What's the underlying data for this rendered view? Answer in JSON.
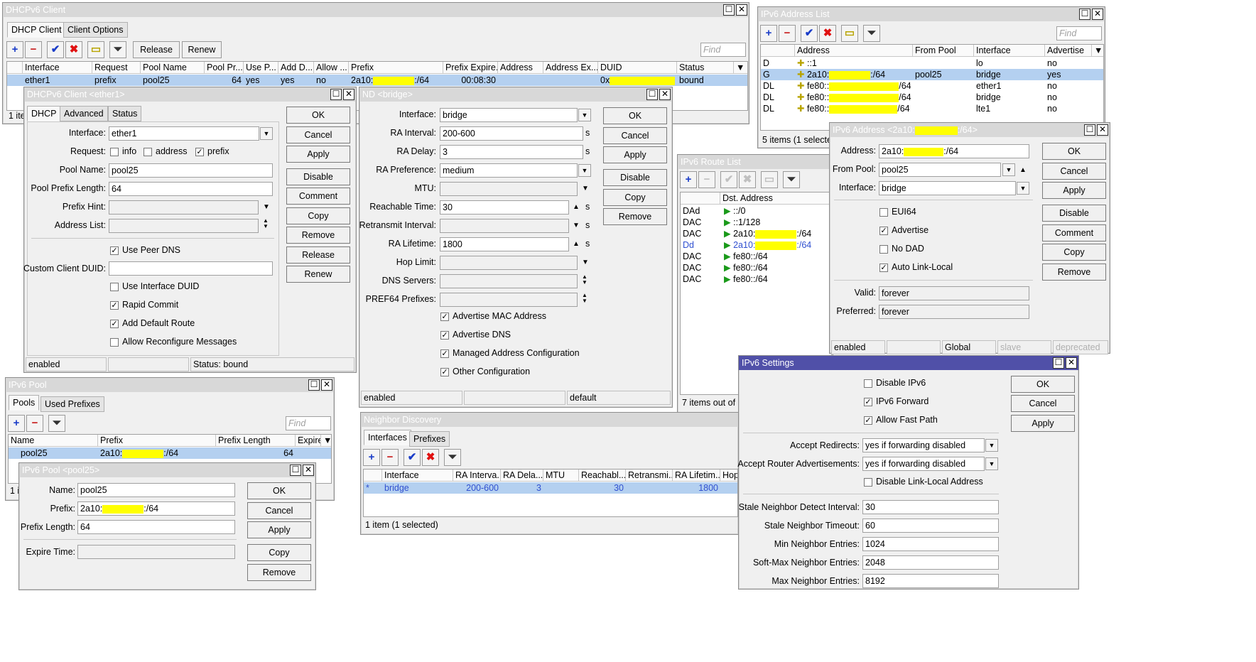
{
  "dhcp_client": {
    "title": "DHCPv6 Client",
    "tabs": [
      "DHCP Client",
      "Client Options"
    ],
    "release": "Release",
    "renew": "Renew",
    "find": "Find",
    "columns": [
      "Interface",
      "Request",
      "Pool Name",
      "Pool Pr...",
      "Use P...",
      "Add D...",
      "Allow ...",
      "Prefix",
      "Prefix Expire...",
      "Address",
      "Address Ex...",
      "DUID",
      "Status"
    ],
    "row": {
      "interface": "ether1",
      "request": "prefix",
      "pool_name": "pool25",
      "pool_prefix": "64",
      "use_peer": "yes",
      "add_default": "yes",
      "allow": "no",
      "prefix_a": "2a10:",
      "prefix_b": ":/64",
      "prefix_expire": "00:08:30",
      "duid": "0x",
      "status": "bound"
    },
    "items": "1 ite"
  },
  "dhcp_edit": {
    "title": "DHCPv6 Client <ether1>",
    "tabs": [
      "DHCP",
      "Advanced",
      "Status"
    ],
    "labels": {
      "interface": "Interface:",
      "request": "Request:",
      "pool_name": "Pool Name:",
      "pool_prefix_length": "Pool Prefix Length:",
      "prefix_hint": "Prefix Hint:",
      "address_list": "Address List:",
      "custom_duid": "Custom Client DUID:"
    },
    "values": {
      "interface": "ether1",
      "pool_name": "pool25",
      "pool_prefix_length": "64"
    },
    "request_opts": [
      "info",
      "address",
      "prefix"
    ],
    "checks": {
      "use_peer_dns": "Use Peer DNS",
      "use_interface_duid": "Use Interface DUID",
      "rapid_commit": "Rapid Commit",
      "add_default_route": "Add Default Route",
      "allow_reconfigure": "Allow Reconfigure Messages"
    },
    "buttons": [
      "OK",
      "Cancel",
      "Apply",
      "Disable",
      "Comment",
      "Copy",
      "Remove",
      "Release",
      "Renew"
    ],
    "status": {
      "state": "enabled",
      "mid": "",
      "status": "Status: bound"
    }
  },
  "nd_edit": {
    "title": "ND <bridge>",
    "labels": {
      "interface": "Interface:",
      "ra_interval": "RA Interval:",
      "ra_delay": "RA Delay:",
      "ra_pref": "RA Preference:",
      "mtu": "MTU:",
      "reach": "Reachable Time:",
      "retrans": "Retransmit Interval:",
      "ra_life": "RA Lifetime:",
      "hop": "Hop Limit:",
      "dns": "DNS Servers:",
      "pref64": "PREF64 Prefixes:"
    },
    "values": {
      "interface": "bridge",
      "ra_interval": "200-600",
      "ra_delay": "3",
      "ra_pref": "medium",
      "reach": "30",
      "ra_life": "1800"
    },
    "unit": "s",
    "checks": {
      "adv_mac": "Advertise MAC Address",
      "adv_dns": "Advertise DNS",
      "managed": "Managed Address Configuration",
      "other": "Other Configuration"
    },
    "buttons": [
      "OK",
      "Cancel",
      "Apply",
      "Disable",
      "Copy",
      "Remove"
    ],
    "status": {
      "state": "enabled",
      "mid": "",
      "right": "default"
    }
  },
  "addr_list": {
    "title": "IPv6 Address List",
    "find": "Find",
    "columns": [
      "Address",
      "From Pool",
      "Interface",
      "Advertise"
    ],
    "rows": [
      {
        "flag": "D",
        "addr_a": "::1",
        "addr_b": "",
        "pool": "",
        "iface": "lo",
        "adv": "no",
        "hl": 0
      },
      {
        "flag": "G",
        "addr_a": "2a10:",
        "addr_b": ":/64",
        "pool": "pool25",
        "iface": "bridge",
        "adv": "yes",
        "hl": 58
      },
      {
        "flag": "DL",
        "addr_a": "fe80::",
        "addr_b": "/64",
        "pool": "",
        "iface": "ether1",
        "adv": "no",
        "hl": 98
      },
      {
        "flag": "DL",
        "addr_a": "fe80::",
        "addr_b": "/64",
        "pool": "",
        "iface": "bridge",
        "adv": "no",
        "hl": 98
      },
      {
        "flag": "DL",
        "addr_a": "fe80::",
        "addr_b": "/64",
        "pool": "",
        "iface": "lte1",
        "adv": "no",
        "hl": 96
      }
    ],
    "items": "5 items (1 selecte"
  },
  "addr_edit": {
    "title_a": "IPv6 Address <2a10:",
    "title_b": ":/64>",
    "labels": {
      "address": "Address:",
      "from_pool": "From Pool:",
      "interface": "Interface:",
      "valid": "Valid:",
      "preferred": "Preferred:"
    },
    "values": {
      "address_a": "2a10:",
      "address_b": ":/64",
      "from_pool": "pool25",
      "interface": "bridge",
      "valid": "forever",
      "preferred": "forever"
    },
    "checks": {
      "eui64": "EUI64",
      "advertise": "Advertise",
      "no_dad": "No DAD",
      "auto_ll": "Auto Link-Local"
    },
    "buttons": [
      "OK",
      "Cancel",
      "Apply",
      "Disable",
      "Comment",
      "Copy",
      "Remove"
    ],
    "status": [
      "enabled",
      "",
      "Global",
      "slave",
      "deprecated"
    ]
  },
  "route_list": {
    "title": "IPv6 Route List",
    "column": "Dst. Address",
    "rows": [
      {
        "flag": "DAd",
        "dst_a": "::/0",
        "dst_b": "",
        "hl": 0
      },
      {
        "flag": "DAC",
        "dst_a": "::1/128",
        "dst_b": "",
        "hl": 0
      },
      {
        "flag": "DAC",
        "dst_a": "2a10:",
        "dst_b": ":/64",
        "hl": 58
      },
      {
        "flag": "Dd",
        "dst_a": "2a10:",
        "dst_b": ":/64",
        "hl": 58
      },
      {
        "flag": "DAC",
        "dst_a": "fe80::/64",
        "dst_b": "",
        "hl": 0
      },
      {
        "flag": "DAC",
        "dst_a": "fe80::/64",
        "dst_b": "",
        "hl": 0
      },
      {
        "flag": "DAC",
        "dst_a": "fe80::/64",
        "dst_b": "",
        "hl": 0
      }
    ],
    "items": "7 items out of 1"
  },
  "pool": {
    "title": "IPv6 Pool",
    "tabs": [
      "Pools",
      "Used Prefixes"
    ],
    "find": "Find",
    "columns": [
      "Name",
      "Prefix",
      "Prefix Length",
      "Expire"
    ],
    "row": {
      "name": "pool25",
      "prefix_a": "2a10:",
      "prefix_b": ":/64",
      "len": "64"
    },
    "items": "1 i"
  },
  "pool_edit": {
    "title": "IPv6 Pool <pool25>",
    "labels": {
      "name": "Name:",
      "prefix": "Prefix:",
      "prefix_length": "Prefix Length:",
      "expire": "Expire Time:"
    },
    "values": {
      "name": "pool25",
      "prefix_a": "2a10:",
      "prefix_b": ":/64",
      "prefix_length": "64"
    },
    "buttons": [
      "OK",
      "Cancel",
      "Apply",
      "Copy",
      "Remove"
    ]
  },
  "nd_list": {
    "title": "Neighbor Discovery",
    "tabs": [
      "Interfaces",
      "Prefixes"
    ],
    "columns": [
      "Interface",
      "RA Interva...",
      "RA Dela...",
      "MTU",
      "Reachabl...",
      "Retransmi...",
      "RA Lifetim...",
      "Hop"
    ],
    "row": {
      "mark": "*",
      "iface": "bridge",
      "ra_interval": "200-600",
      "ra_delay": "3",
      "mtu": "",
      "reach": "30",
      "retrans": "",
      "ra_life": "1800"
    },
    "items": "1 item (1 selected)"
  },
  "settings": {
    "title": "IPv6 Settings",
    "checks": {
      "disable": "Disable IPv6",
      "forward": "IPv6 Forward",
      "fast": "Allow Fast Path",
      "disable_ll": "Disable Link-Local Address"
    },
    "labels": {
      "redirects": "Accept Redirects:",
      "ra": "Accept Router Advertisements:",
      "stale_int": "Stale Neighbor Detect Interval:",
      "stale_to": "Stale Neighbor Timeout:",
      "min": "Min Neighbor Entries:",
      "softmax": "Soft-Max Neighbor Entries:",
      "max": "Max Neighbor Entries:"
    },
    "values": {
      "redirects": "yes if forwarding disabled",
      "ra": "yes if forwarding disabled",
      "stale_int": "30",
      "stale_to": "60",
      "min": "1024",
      "softmax": "2048",
      "max": "8192"
    },
    "buttons": [
      "OK",
      "Cancel",
      "Apply"
    ]
  },
  "icons": {
    "add": "+",
    "remove": "−",
    "enable": "✔",
    "disable": "✖",
    "comment": "▭",
    "filter": "⏷",
    "close": "✕",
    "maximize": "☐",
    "dropdown": "▼",
    "up": "▲",
    "down": "▼"
  }
}
